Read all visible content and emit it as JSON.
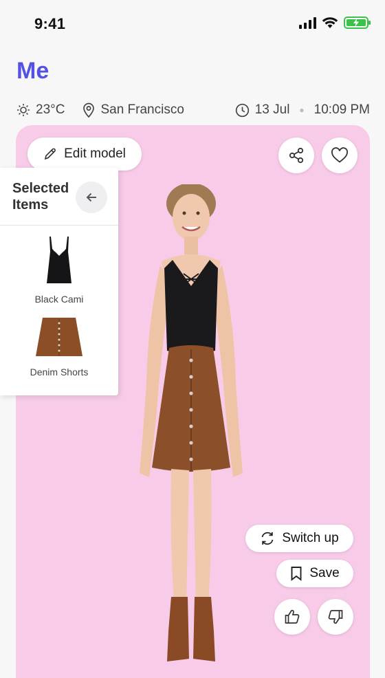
{
  "status": {
    "time": "9:41"
  },
  "header": {
    "title": "Me"
  },
  "info": {
    "temperature": "23°C",
    "location": "San Francisco",
    "date": "13 Jul",
    "time": "10:09 PM"
  },
  "stage": {
    "edit_label": "Edit model",
    "switch_label": "Switch up",
    "save_label": "Save"
  },
  "panel": {
    "title": "Selected Items",
    "items": [
      {
        "label": "Black Cami"
      },
      {
        "label": "Denim Shorts"
      }
    ]
  },
  "colors": {
    "accent": "#5452e5",
    "stage_bg": "#f8cbe8",
    "battery": "#3cc24a"
  }
}
